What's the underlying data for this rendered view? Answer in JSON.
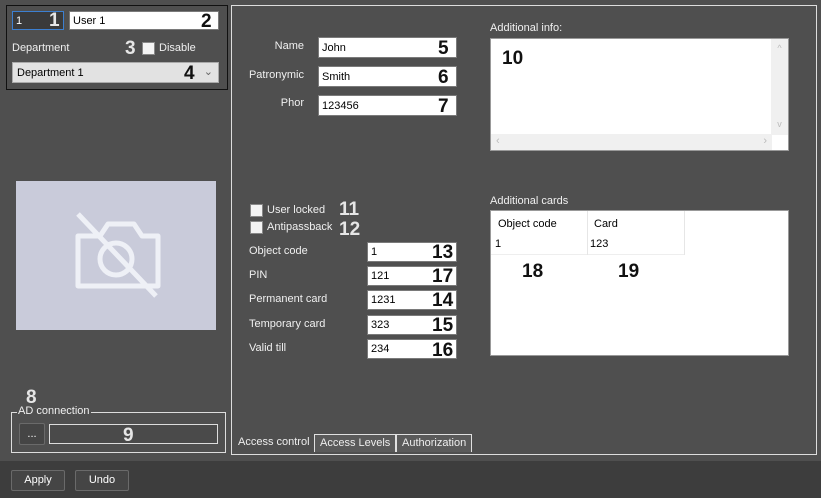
{
  "header": {
    "id_value": "1",
    "user_name": "User 1",
    "department_label": "Department",
    "disable_label": "Disable",
    "department_value": "Department 1"
  },
  "ad": {
    "title": "AD connection",
    "browse_label": "...",
    "value": ""
  },
  "main": {
    "name_label": "Name",
    "name_value": "John",
    "patronymic_label": "Patronymic",
    "patronymic_value": "Smith",
    "phone_label": "Phor",
    "phone_value": "123456",
    "additional_info_label": "Additional info:",
    "user_locked_label": "User locked",
    "antipassback_label": "Antipassback",
    "object_code_label": "Object code",
    "object_code_value": "1",
    "pin_label": "PIN",
    "pin_value": "121",
    "permanent_card_label": "Permanent card",
    "permanent_card_value": "1231",
    "temporary_card_label": "Temporary card",
    "temporary_card_value": "323",
    "valid_till_label": "Valid till",
    "valid_till_value": "234",
    "additional_cards_label": "Additional cards",
    "cards_table": {
      "columns": [
        "Object code",
        "Card"
      ],
      "rows": [
        [
          "1",
          "123"
        ]
      ]
    }
  },
  "tabs": [
    "Access control",
    "Access Levels",
    "Authorization"
  ],
  "footer": {
    "apply": "Apply",
    "undo": "Undo"
  },
  "annotations": [
    "1",
    "2",
    "3",
    "4",
    "5",
    "6",
    "7",
    "8",
    "9",
    "10",
    "11",
    "12",
    "13",
    "14",
    "15",
    "16",
    "17",
    "18",
    "19"
  ],
  "icons": {
    "photo": "no-camera-icon",
    "dropdown": "chevron-down-icon"
  }
}
